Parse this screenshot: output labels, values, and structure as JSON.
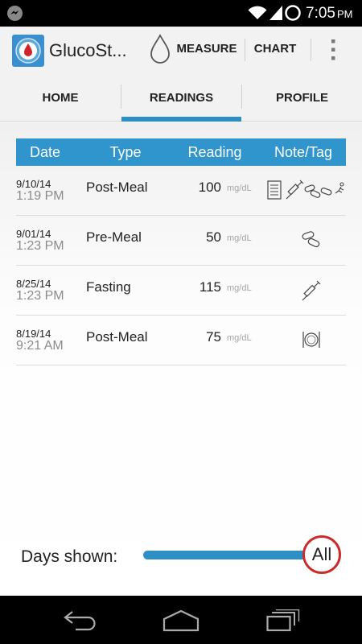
{
  "status_bar": {
    "time": "7:05",
    "ampm": "PM"
  },
  "app": {
    "title": "GlucoSt..."
  },
  "action_bar": {
    "measure_label": "MEASURE",
    "chart_label": "CHART"
  },
  "tabs": [
    {
      "label": "HOME",
      "selected": false
    },
    {
      "label": "READINGS",
      "selected": true
    },
    {
      "label": "PROFILE",
      "selected": false
    }
  ],
  "table": {
    "headers": {
      "date": "Date",
      "type": "Type",
      "reading": "Reading",
      "note": "Note/Tag"
    },
    "rows": [
      {
        "date": "9/10/14",
        "time": "1:19 PM",
        "type": "Post-Meal",
        "value": "100",
        "unit": "mg/dL",
        "tags": [
          "note-icon",
          "syringe-icon",
          "pills-icon",
          "pills-icon",
          "exercise-icon"
        ]
      },
      {
        "date": "9/01/14",
        "time": "1:23 PM",
        "type": "Pre-Meal",
        "value": "50",
        "unit": "mg/dL",
        "tags": [
          "pills-icon"
        ]
      },
      {
        "date": "8/25/14",
        "time": "1:23 PM",
        "type": "Fasting",
        "value": "115",
        "unit": "mg/dL",
        "tags": [
          "syringe-icon"
        ]
      },
      {
        "date": "8/19/14",
        "time": "9:21 AM",
        "type": "Post-Meal",
        "value": "75",
        "unit": "mg/dL",
        "tags": [
          "meal-icon"
        ]
      }
    ]
  },
  "days_filter": {
    "label": "Days shown:",
    "value": "All",
    "level": 1.0
  },
  "colors": {
    "accent": "#2f95cc",
    "slider_thumb_border": "#cc2b2b",
    "tab_underline": "#2b8ec4"
  }
}
